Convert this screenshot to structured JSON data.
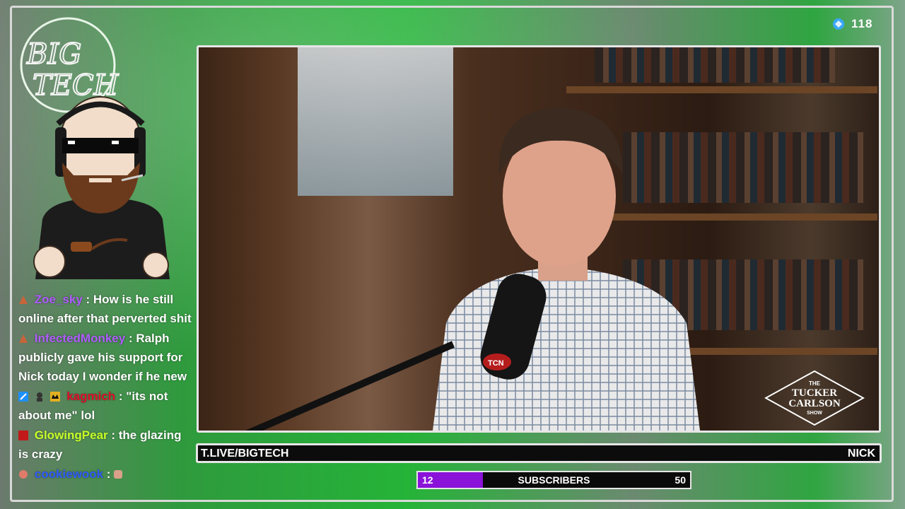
{
  "stream": {
    "viewer_count": "118",
    "logo_text_top": "BIG",
    "logo_text_bottom": "TECH"
  },
  "video": {
    "show_logo": {
      "line1": "THE",
      "line2": "TUCKER",
      "line3": "CARLSON",
      "line4": "SHOW"
    },
    "mic_label": "TCN"
  },
  "ticker": {
    "left_text": "T.LIVE/BIGTECH",
    "right_text": "NICK"
  },
  "subscribers": {
    "current": "12",
    "label": "SUBSCRIBERS",
    "goal": "50",
    "progress_fraction": 0.24
  },
  "chat": {
    "messages": [
      {
        "user": "Zoe_sky",
        "user_color": "#b05cff",
        "separator": " : ",
        "text": "How is he still online after that perverted shit"
      },
      {
        "user": "InfectedMonkey",
        "user_color": "#b05cff",
        "separator": " : ",
        "text": "Ralph publicly gave his support for Nick today I wonder if he new"
      },
      {
        "user": "kagmich",
        "user_color": "#e0102a",
        "separator": " : ",
        "text": "\"its not about me\" lol"
      },
      {
        "user": "GlowingPear",
        "user_color": "#c8ff2a",
        "separator": " : ",
        "text": "the glazing is crazy"
      },
      {
        "user": "cookiewook",
        "user_color": "#2f5cff",
        "separator": " : ",
        "text": ""
      }
    ]
  },
  "colors": {
    "accent_green": "#25b338",
    "sub_fill": "#8a12d9",
    "border": "#e6e6e6"
  }
}
